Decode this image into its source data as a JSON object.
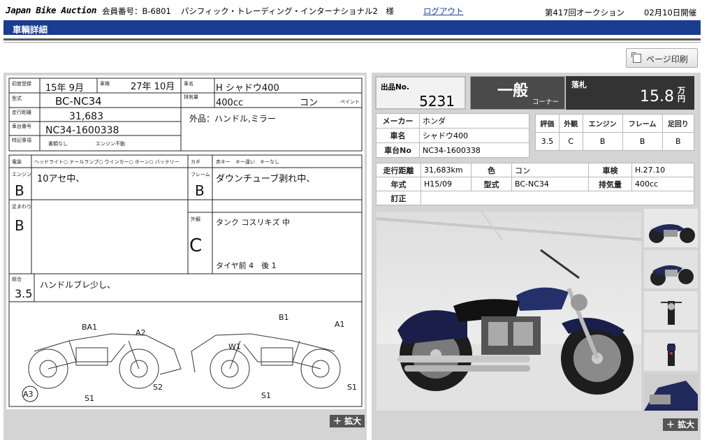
{
  "header": {
    "logo": "Japan Bike Auction",
    "member_label": "会員番号：B-6801",
    "member_name": "パシフィック・トレーディング・インターナショナル2　様",
    "logout": "ログアウト",
    "auction_no": "第417回オークション",
    "date": "02月10日開催"
  },
  "page_title": "車輌詳細",
  "print_label": "ページ印刷",
  "zoom_label": "＋ 拡大",
  "sheet": {
    "first_reg_label": "初度登録",
    "first_reg": "15年 9月",
    "inspection_label": "車検",
    "inspection": "27年 10月",
    "model_name_label": "車名",
    "model_name": "H シャドウ400",
    "type_label": "型式",
    "type": "BC-NC34",
    "displacement_label": "排気量",
    "displacement": "400cc",
    "color_label": "ペイント",
    "color": "コン",
    "mileage_label": "走行距離",
    "mileage": "31,683",
    "frame_no_label": "車台番号",
    "frame_no": "NC34-1600338",
    "exterior_note": "外品：ハンドル,ミラー",
    "special_label": "特記事項",
    "special_1": "書類なし",
    "special_2": "エンジン不動",
    "electrical_label": "電装",
    "electrical_items": "ヘッドライト○ テールランプ○ ウインカー○ ホーン○ バッテリー",
    "key_label": "カギ",
    "key_items": "赤キー　キー違い　キーなし",
    "engine_label": "エンジン",
    "engine_grade": "B",
    "engine_note": "10アセ中、",
    "frame_label": "フレーム",
    "frame_grade": "B",
    "frame_note": "ダウンチューブ剥れ中、",
    "suspension_label": "足まわり",
    "suspension_grade": "B",
    "appearance_label": "外観",
    "appearance_grade": "C",
    "appearance_note": "タンク コスリキズ 中",
    "tire_note": "タイヤ前 4　後 1",
    "total_label": "総合",
    "total_score": "3.5",
    "total_note": "ハンドルブレ少し、",
    "diagram_left": [
      "BA1",
      "A2",
      "A3",
      "S2",
      "S1"
    ],
    "diagram_right": [
      "B1",
      "A1",
      "W1",
      "S1",
      "S1"
    ]
  },
  "lot": {
    "label": "出品No.",
    "number": "5231"
  },
  "corner": {
    "main": "一般",
    "sub": "コーナー"
  },
  "bid": {
    "label": "落札",
    "value": "15.8",
    "unit_top": "万",
    "unit_bottom": "円"
  },
  "specs": {
    "maker_label": "メーカー",
    "maker": "ホンダ",
    "model_label": "車名",
    "model": "シャドウ400",
    "frame_label": "車台No",
    "frame": "NC34-1600338"
  },
  "grades": {
    "headers": [
      "評価",
      "外観",
      "エンジン",
      "フレーム",
      "足回り"
    ],
    "values": [
      "3.5",
      "C",
      "B",
      "B",
      "B"
    ]
  },
  "details": {
    "mileage_label": "走行距離",
    "mileage": "31,683km",
    "color_label": "色",
    "color": "コン",
    "inspection_label": "車検",
    "inspection": "H.27.10",
    "year_label": "年式",
    "year": "H15/09",
    "type_label": "型式",
    "type": "BC-NC34",
    "displacement_label": "排気量",
    "displacement": "400cc",
    "correction_label": "訂正",
    "correction": ""
  },
  "photos": {
    "main": "motorcycle-side-photo",
    "thumbs": [
      "thumb-side",
      "thumb-front-quarter",
      "thumb-front",
      "thumb-rear",
      "thumb-detail"
    ]
  }
}
